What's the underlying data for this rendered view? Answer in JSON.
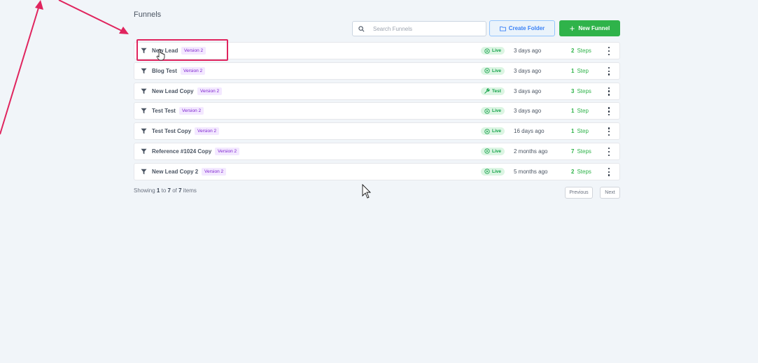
{
  "page_title": "Funnels",
  "toolbar": {
    "search_placeholder": "Search Funnels",
    "create_folder_label": "Create Folder",
    "new_funnel_label": "New Funnel"
  },
  "funnels": [
    {
      "name": "New Lead",
      "version": "Version 2",
      "status": "Live",
      "updated": "3 days ago",
      "steps_count": "2",
      "steps_label": "Steps"
    },
    {
      "name": "Blog Test",
      "version": "Version 2",
      "status": "Live",
      "updated": "3 days ago",
      "steps_count": "1",
      "steps_label": "Step"
    },
    {
      "name": "New Lead Copy",
      "version": "Version 2",
      "status": "Test",
      "updated": "3 days ago",
      "steps_count": "3",
      "steps_label": "Steps"
    },
    {
      "name": "Test Test",
      "version": "Version 2",
      "status": "Live",
      "updated": "3 days ago",
      "steps_count": "1",
      "steps_label": "Step"
    },
    {
      "name": "Test Test Copy",
      "version": "Version 2",
      "status": "Live",
      "updated": "16 days ago",
      "steps_count": "1",
      "steps_label": "Step"
    },
    {
      "name": "Reference #1024 Copy",
      "version": "Version 2",
      "status": "Live",
      "updated": "2 months ago",
      "steps_count": "7",
      "steps_label": "Steps"
    },
    {
      "name": "New Lead Copy 2",
      "version": "Version 2",
      "status": "Live",
      "updated": "5 months ago",
      "steps_count": "2",
      "steps_label": "Steps"
    }
  ],
  "pagination": {
    "prefix": "Showing",
    "from": "1",
    "to_word": "to",
    "to": "7",
    "of_word": "of",
    "total": "7",
    "suffix": "items",
    "previous_label": "Previous",
    "next_label": "Next"
  },
  "colors": {
    "accent_green": "#2fb34a",
    "annotation_pink": "#e0245e",
    "version_purple": "#7e22ce",
    "folder_blue": "#3b82f6"
  }
}
